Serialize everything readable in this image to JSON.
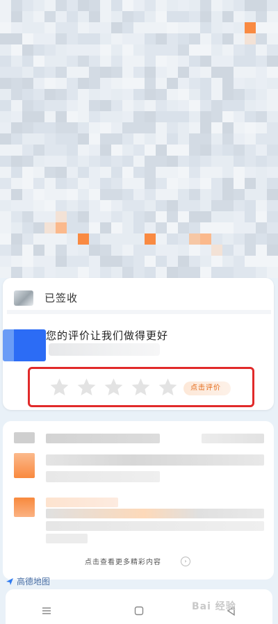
{
  "status_card": {
    "status": "已签收",
    "rating_prompt": "您的评价让我们做得更好",
    "rate_button": "点击评价",
    "star_count": 5,
    "star_color": "#e3e3e3"
  },
  "list_card": {
    "more_link": "点击查看更多精彩内容"
  },
  "brand": {
    "name": "高德地图",
    "color": "#4a6fa5"
  },
  "navbar": {
    "icons": [
      "menu-icon",
      "home-square-icon",
      "back-triangle-icon"
    ]
  },
  "watermark": {
    "text": "Bai 经验"
  },
  "colors": {
    "highlight_box": "#e12a2a",
    "rate_button_text": "#e46b1a"
  }
}
